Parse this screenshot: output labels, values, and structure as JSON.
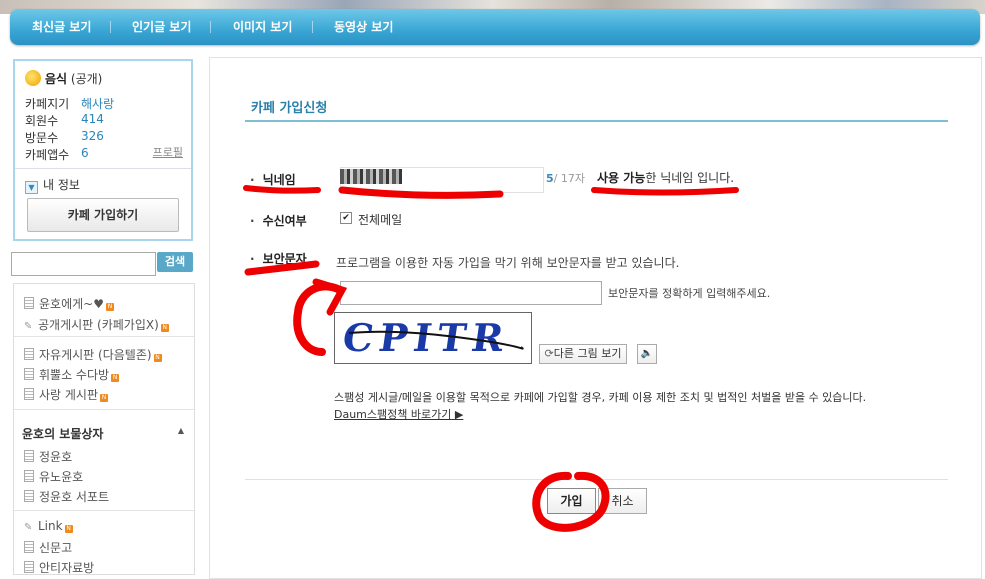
{
  "topnav": {
    "items": [
      "최신글 보기",
      "인기글 보기",
      "이미지 보기",
      "동영상 보기"
    ]
  },
  "cafe": {
    "category": "음식",
    "visibility": "(공개)",
    "rows": [
      {
        "label": "카페지기",
        "value": "해사랑"
      },
      {
        "label": "회원수",
        "value": "414"
      },
      {
        "label": "방문수",
        "value": "326"
      },
      {
        "label": "카페앱수",
        "value": "6"
      }
    ],
    "profile_link": "프로필",
    "my_info": "내 정보",
    "join_button": "카페 가입하기"
  },
  "search": {
    "button": "검색",
    "placeholder": ""
  },
  "menu": {
    "group1": [
      "윤호에게~♥",
      "공개게시판 (카페가입X)"
    ],
    "group2": [
      "자유게시판 (다음텔존)",
      "휘뿔소 수다방",
      "사랑 게시판"
    ],
    "section_title": "윤호의 보물상자",
    "section_arrow": "▲",
    "group3": [
      "정윤호",
      "유노윤호",
      "정윤호 서포트"
    ],
    "group4": [
      "Link",
      "신문고",
      "안티자료방"
    ]
  },
  "form": {
    "title": "카페 가입신청",
    "nickname_label": "닉네임",
    "nickname_count": "5",
    "nickname_max": "/ 17자",
    "avail_bold": "사용 가능",
    "avail_rest": "한 닉네임 입니다.",
    "receive_label": "수신여부",
    "receive_option": "전체메일",
    "security_label": "보안문자",
    "security_desc": "프로그램을 이용한 자동 가입을 막기 위해 보안문자를 받고 있습니다.",
    "security_hint": "보안문자를 정확하게 입력해주세요.",
    "captcha_text": "CPITR",
    "refresh_button": "다른 그림 보기",
    "warning": "스팸성 게시글/메일을 이용할 목적으로 카페에 가입할 경우, 카페 이용 제한 조치 및 법적인 처벌을 받을 수 있습니다.",
    "policy_link": "Daum스팸정책 바로가기",
    "join_button": "가입",
    "cancel_button": "취소"
  },
  "colors": {
    "nav": "#3aa6d4",
    "accent_text": "#2a80aa",
    "annotation_red": "#ee0000",
    "captcha": "#1a3aa8"
  }
}
